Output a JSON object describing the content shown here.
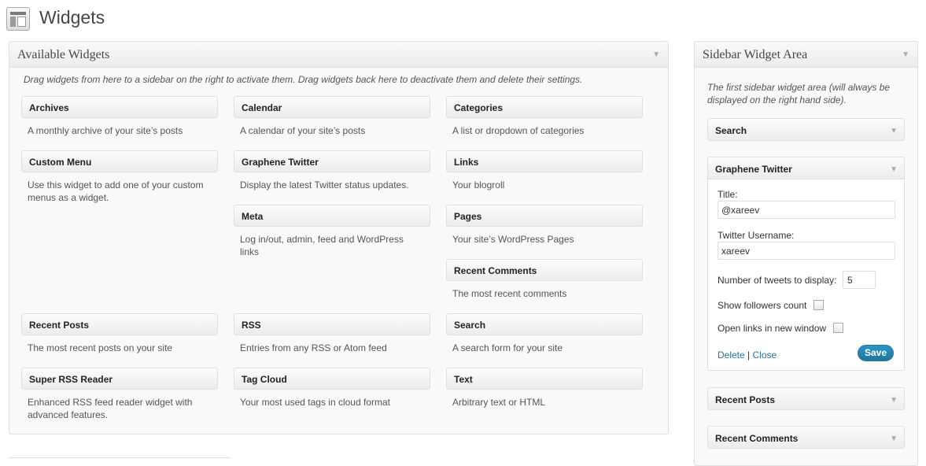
{
  "page": {
    "title": "Widgets"
  },
  "available": {
    "title": "Available Widgets",
    "description": "Drag widgets from here to a sidebar on the right to activate them. Drag widgets back here to deactivate them and delete their settings.",
    "widgets": [
      {
        "name": "Archives",
        "desc": "A monthly archive of your site’s posts"
      },
      {
        "name": "Calendar",
        "desc": "A calendar of your site’s posts"
      },
      {
        "name": "Categories",
        "desc": "A list or dropdown of categories"
      },
      {
        "name": "Custom Menu",
        "desc": "Use this widget to add one of your custom menus as a widget."
      },
      {
        "name": "Graphene Twitter",
        "desc": "Display the latest Twitter status updates."
      },
      {
        "name": "Links",
        "desc": "Your blogroll"
      },
      {
        "name": "Meta",
        "desc": "Log in/out, admin, feed and WordPress links"
      },
      {
        "name": "Pages",
        "desc": "Your site’s WordPress Pages"
      },
      {
        "name": "Recent Comments",
        "desc": "The most recent comments"
      },
      {
        "name": "Recent Posts",
        "desc": "The most recent posts on your site"
      },
      {
        "name": "RSS",
        "desc": "Entries from any RSS or Atom feed"
      },
      {
        "name": "Search",
        "desc": "A search form for your site"
      },
      {
        "name": "Super RSS Reader",
        "desc": "Enhanced RSS feed reader widget with advanced features."
      },
      {
        "name": "Tag Cloud",
        "desc": "Your most used tags in cloud format"
      },
      {
        "name": "Text",
        "desc": "Arbitrary text or HTML"
      }
    ]
  },
  "sidebar": {
    "title": "Sidebar Widget Area",
    "description": "The first sidebar widget area (will always be displayed on the right hand side).",
    "widgets": [
      {
        "name": "Search"
      },
      {
        "name": "Graphene Twitter"
      },
      {
        "name": "Recent Posts"
      },
      {
        "name": "Recent Comments"
      }
    ],
    "twitter_form": {
      "title_label": "Title:",
      "title_value": "@xareev",
      "username_label": "Twitter Username:",
      "username_value": "xareev",
      "count_label": "Number of tweets to display:",
      "count_value": "5",
      "followers_label": "Show followers count",
      "followers_checked": false,
      "newwindow_label": "Open links in new window",
      "newwindow_checked": false,
      "delete_label": "Delete",
      "separator": "|",
      "close_label": "Close",
      "save_label": "Save"
    }
  },
  "colors": {
    "link": "#21759b",
    "primary_button": "#21759b"
  }
}
